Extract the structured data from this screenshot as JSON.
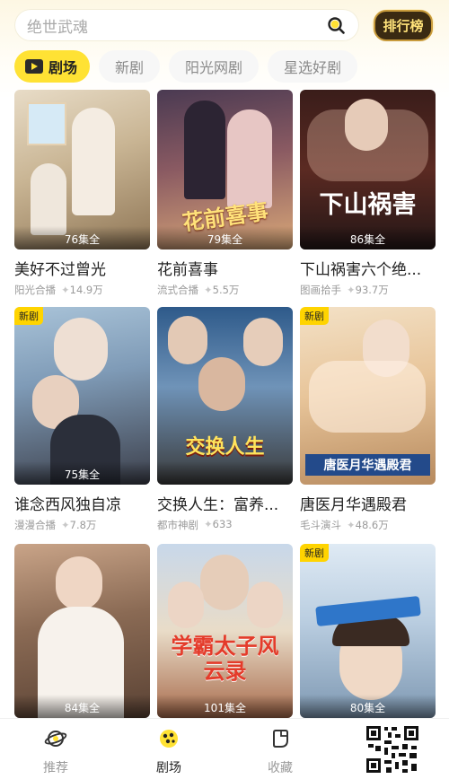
{
  "search": {
    "placeholder": "绝世武魂"
  },
  "rank_label": "排行榜",
  "tabs": [
    {
      "label": "剧场",
      "active": true
    },
    {
      "label": "新剧",
      "active": false
    },
    {
      "label": "阳光网剧",
      "active": false
    },
    {
      "label": "星选好剧",
      "active": false
    }
  ],
  "dramas": [
    {
      "title": "美好不过曾光",
      "source": "阳光合播",
      "views": "14.9万",
      "episodes": "76集全",
      "new": false,
      "poster_text": ""
    },
    {
      "title": "花前喜事",
      "source": "流式合播",
      "views": "5.5万",
      "episodes": "79集全",
      "new": false,
      "poster_text": "花前喜事"
    },
    {
      "title": "下山祸害六个绝...",
      "source": "图画拾手",
      "views": "93.7万",
      "episodes": "86集全",
      "new": false,
      "poster_text": "下山祸害"
    },
    {
      "title": "谁念西风独自凉",
      "source": "漫漫合播",
      "views": "7.8万",
      "episodes": "75集全",
      "new": true,
      "poster_text": ""
    },
    {
      "title": "交换人生：富养...",
      "source": "都市神剧",
      "views": "633",
      "episodes": "",
      "new": false,
      "poster_text": "交换人生"
    },
    {
      "title": "唐医月华遇殿君",
      "source": "毛斗演斗",
      "views": "48.6万",
      "episodes": "",
      "new": true,
      "poster_text": "唐医月华遇殿君"
    },
    {
      "title": "",
      "source": "",
      "views": "",
      "episodes": "84集全",
      "new": false,
      "poster_text": ""
    },
    {
      "title": "",
      "source": "",
      "views": "",
      "episodes": "101集全",
      "new": false,
      "poster_text": "学霸太子风云录"
    },
    {
      "title": "",
      "source": "",
      "views": "",
      "episodes": "80集全",
      "new": true,
      "poster_text": ""
    }
  ],
  "bottom_nav": [
    {
      "label": "推荐",
      "icon": "planet-icon",
      "active": false
    },
    {
      "label": "剧场",
      "icon": "theater-icon",
      "active": true
    },
    {
      "label": "收藏",
      "icon": "bookmark-icon",
      "active": false
    }
  ],
  "colors": {
    "accent": "#ffe234",
    "badge": "#ffd400",
    "muted": "#9a9a9a"
  }
}
